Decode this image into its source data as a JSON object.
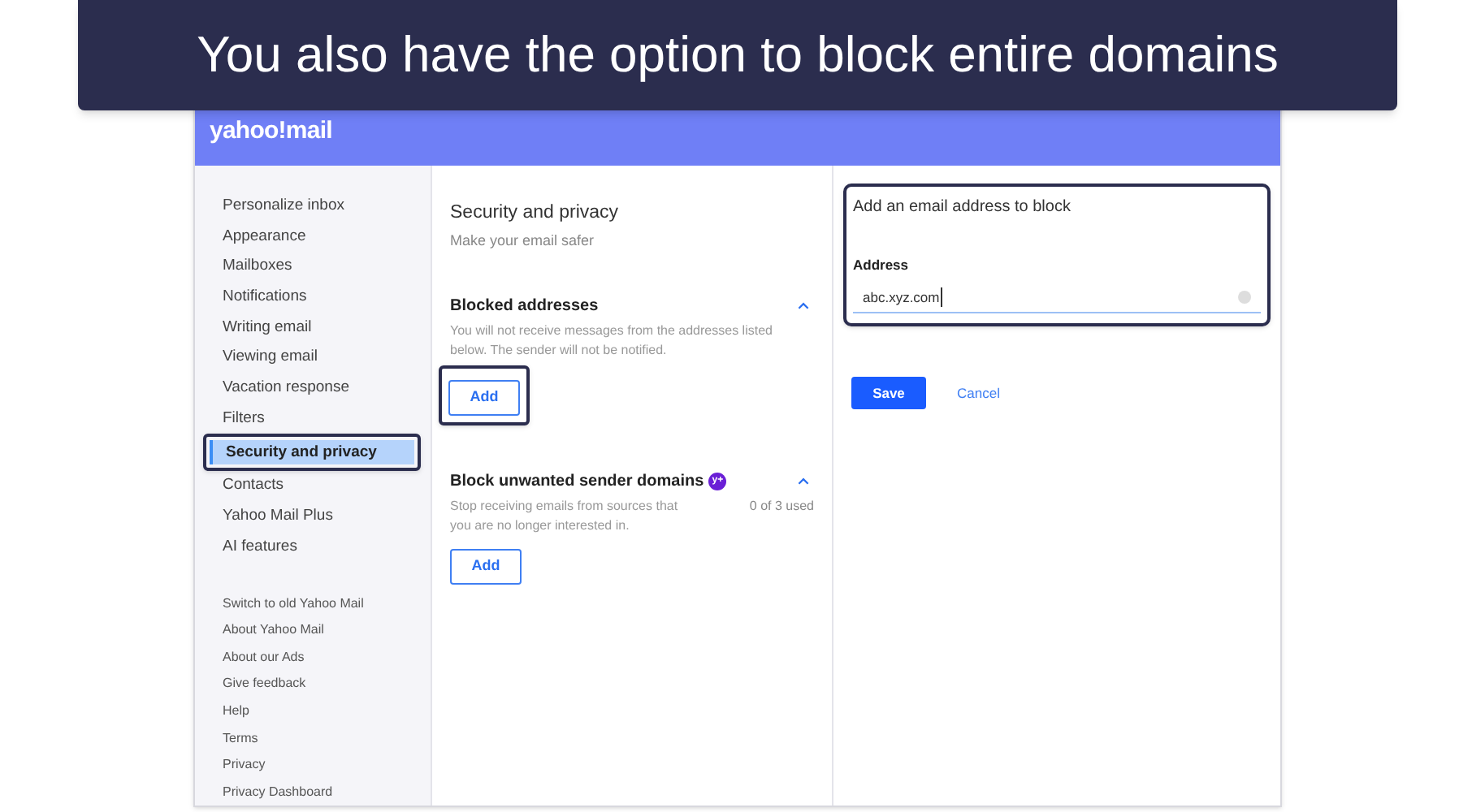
{
  "banner": {
    "text": "You also have the option to block entire domains"
  },
  "header": {
    "logo": "yahoo!mail"
  },
  "sidebar": {
    "items": [
      {
        "label": "Personalize inbox",
        "selected": false,
        "callout": false
      },
      {
        "label": "Appearance",
        "selected": false,
        "callout": false
      },
      {
        "label": "Mailboxes",
        "selected": false,
        "callout": false
      },
      {
        "label": "Notifications",
        "selected": false,
        "callout": false
      },
      {
        "label": "Writing email",
        "selected": false,
        "callout": false
      },
      {
        "label": "Viewing email",
        "selected": false,
        "callout": false
      },
      {
        "label": "Vacation response",
        "selected": false,
        "callout": false
      },
      {
        "label": "Filters",
        "selected": false,
        "callout": false
      },
      {
        "label": "Security and privacy",
        "selected": true,
        "callout": true
      },
      {
        "label": "Contacts",
        "selected": false,
        "callout": false
      },
      {
        "label": "Yahoo Mail Plus",
        "selected": false,
        "callout": false
      },
      {
        "label": "AI features",
        "selected": false,
        "callout": false
      }
    ],
    "links": [
      "Switch to old Yahoo Mail",
      "About Yahoo Mail",
      "About our Ads",
      "Give feedback",
      "Help",
      "Terms",
      "Privacy",
      "Privacy Dashboard"
    ]
  },
  "content": {
    "title": "Security and privacy",
    "subtitle": "Make your email safer",
    "sections": [
      {
        "title": "Blocked addresses",
        "description": "You will not receive messages from the addresses listed below. The sender will not be notified.",
        "button": "Add",
        "expanded": true,
        "callout": true
      },
      {
        "title": "Block unwanted sender domains",
        "badge": "y+",
        "description": "Stop receiving emails from sources that you are no longer interested in.",
        "usage": "0 of 3 used",
        "button": "Add",
        "expanded": true,
        "callout": false
      }
    ]
  },
  "form": {
    "title": "Add an email address to block",
    "field_label": "Address",
    "value": "abc.xyz.com",
    "callout": true,
    "save": "Save",
    "cancel": "Cancel"
  }
}
